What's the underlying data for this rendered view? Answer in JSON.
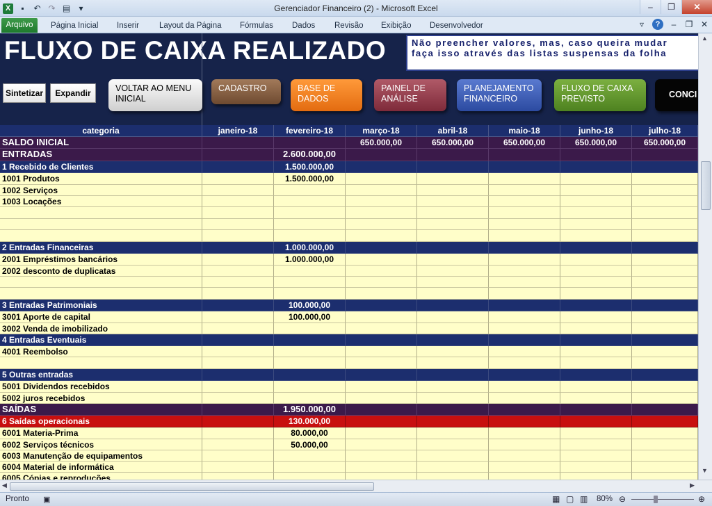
{
  "window": {
    "title": "Gerenciador Financeiro (2)  -  Microsoft Excel"
  },
  "ribbon": {
    "tabs": [
      "Arquivo",
      "Página Inicial",
      "Inserir",
      "Layout da Página",
      "Fórmulas",
      "Dados",
      "Revisão",
      "Exibição",
      "Desenvolvedor"
    ]
  },
  "sheet": {
    "title": "FLUXO DE CAIXA REALIZADO",
    "notice_line1": "Não preencher valores, mas, caso queira mudar",
    "notice_line2": "faça isso através das listas suspensas da folha",
    "btn_sintetizar": "Sintetizar",
    "btn_expandir": "Expandir",
    "nav": [
      "VOLTAR AO MENU INICIAL",
      "CADASTRO",
      "BASE DE DADOS",
      "PAINEL DE ANÁLISE",
      "PLANEJAMENTO FINANCEIRO",
      "FLUXO DE CAIXA PREVISTO",
      "CONCI"
    ],
    "columns": [
      "categoria",
      "janeiro-18",
      "fevereiro-18",
      "março-18",
      "abril-18",
      "maio-18",
      "junho-18",
      "julho-18"
    ],
    "rows": [
      {
        "t": "saldo",
        "cells": [
          "SALDO INICIAL",
          "",
          "",
          "650.000,00",
          "650.000,00",
          "650.000,00",
          "650.000,00",
          "650.000,00"
        ]
      },
      {
        "t": "grp",
        "cells": [
          "ENTRADAS",
          "",
          "2.600.000,00",
          "",
          "",
          "",
          "",
          ""
        ]
      },
      {
        "t": "sub",
        "cells": [
          "1 Recebido de Clientes",
          "",
          "1.500.000,00",
          "",
          "",
          "",
          "",
          ""
        ]
      },
      {
        "t": "it",
        "cells": [
          "1001 Produtos",
          "",
          "1.500.000,00",
          "",
          "",
          "",
          "",
          ""
        ]
      },
      {
        "t": "it",
        "cells": [
          "1002 Serviços",
          "",
          "",
          "",
          "",
          "",
          "",
          ""
        ]
      },
      {
        "t": "it",
        "cells": [
          "1003 Locações",
          "",
          "",
          "",
          "",
          "",
          "",
          ""
        ]
      },
      {
        "t": "it",
        "cells": [
          "",
          "",
          "",
          "",
          "",
          "",
          "",
          ""
        ]
      },
      {
        "t": "it",
        "cells": [
          "",
          "",
          "",
          "",
          "",
          "",
          "",
          ""
        ]
      },
      {
        "t": "it",
        "cells": [
          "",
          "",
          "",
          "",
          "",
          "",
          "",
          ""
        ]
      },
      {
        "t": "sub",
        "cells": [
          "2 Entradas Financeiras",
          "",
          "1.000.000,00",
          "",
          "",
          "",
          "",
          ""
        ]
      },
      {
        "t": "it",
        "cells": [
          "2001 Empréstimos bancários",
          "",
          "1.000.000,00",
          "",
          "",
          "",
          "",
          ""
        ]
      },
      {
        "t": "it",
        "cells": [
          "2002 desconto de duplicatas",
          "",
          "",
          "",
          "",
          "",
          "",
          ""
        ]
      },
      {
        "t": "it",
        "cells": [
          "",
          "",
          "",
          "",
          "",
          "",
          "",
          ""
        ]
      },
      {
        "t": "it",
        "cells": [
          "",
          "",
          "",
          "",
          "",
          "",
          "",
          ""
        ]
      },
      {
        "t": "sub",
        "cells": [
          "3 Entradas Patrimoniais",
          "",
          "100.000,00",
          "",
          "",
          "",
          "",
          ""
        ]
      },
      {
        "t": "it",
        "cells": [
          "3001 Aporte de capital",
          "",
          "100.000,00",
          "",
          "",
          "",
          "",
          ""
        ]
      },
      {
        "t": "it",
        "cells": [
          "3002 Venda de imobilizado",
          "",
          "",
          "",
          "",
          "",
          "",
          ""
        ]
      },
      {
        "t": "sub",
        "cells": [
          "4 Entradas Eventuais",
          "",
          "",
          "",
          "",
          "",
          "",
          ""
        ]
      },
      {
        "t": "it",
        "cells": [
          "4001 Reembolso",
          "",
          "",
          "",
          "",
          "",
          "",
          ""
        ]
      },
      {
        "t": "it",
        "cells": [
          "",
          "",
          "",
          "",
          "",
          "",
          "",
          ""
        ]
      },
      {
        "t": "sub",
        "cells": [
          "5 Outras entradas",
          "",
          "",
          "",
          "",
          "",
          "",
          ""
        ]
      },
      {
        "t": "it",
        "cells": [
          "5001 Dividendos recebidos",
          "",
          "",
          "",
          "",
          "",
          "",
          ""
        ]
      },
      {
        "t": "it",
        "cells": [
          "5002 juros recebidos",
          "",
          "",
          "",
          "",
          "",
          "",
          ""
        ]
      },
      {
        "t": "grp",
        "cells": [
          "SAÍDAS",
          "",
          "1.950.000,00",
          "",
          "",
          "",
          "",
          ""
        ]
      },
      {
        "t": "subred",
        "cells": [
          "6 Saídas operacionais",
          "",
          "130.000,00",
          "",
          "",
          "",
          "",
          ""
        ]
      },
      {
        "t": "it",
        "cells": [
          "6001 Materia-Prima",
          "",
          "80.000,00",
          "",
          "",
          "",
          "",
          ""
        ]
      },
      {
        "t": "it",
        "cells": [
          "6002 Serviços técnicos",
          "",
          "50.000,00",
          "",
          "",
          "",
          "",
          ""
        ]
      },
      {
        "t": "it",
        "cells": [
          "6003 Manutenção de equipamentos",
          "",
          "",
          "",
          "",
          "",
          "",
          ""
        ]
      },
      {
        "t": "it",
        "cells": [
          "6004 Material de informática",
          "",
          "",
          "",
          "",
          "",
          "",
          ""
        ]
      },
      {
        "t": "it",
        "cells": [
          "6005 Cópias e reproduções",
          "",
          "",
          "",
          "",
          "",
          "",
          ""
        ]
      }
    ]
  },
  "status": {
    "text": "Pronto",
    "zoom": "80%"
  },
  "colors": {
    "header_navy": "#16234a",
    "group_purple": "#3b1a4a",
    "cell_yellow": "#fffec9",
    "saida_red": "#c80f0f"
  }
}
